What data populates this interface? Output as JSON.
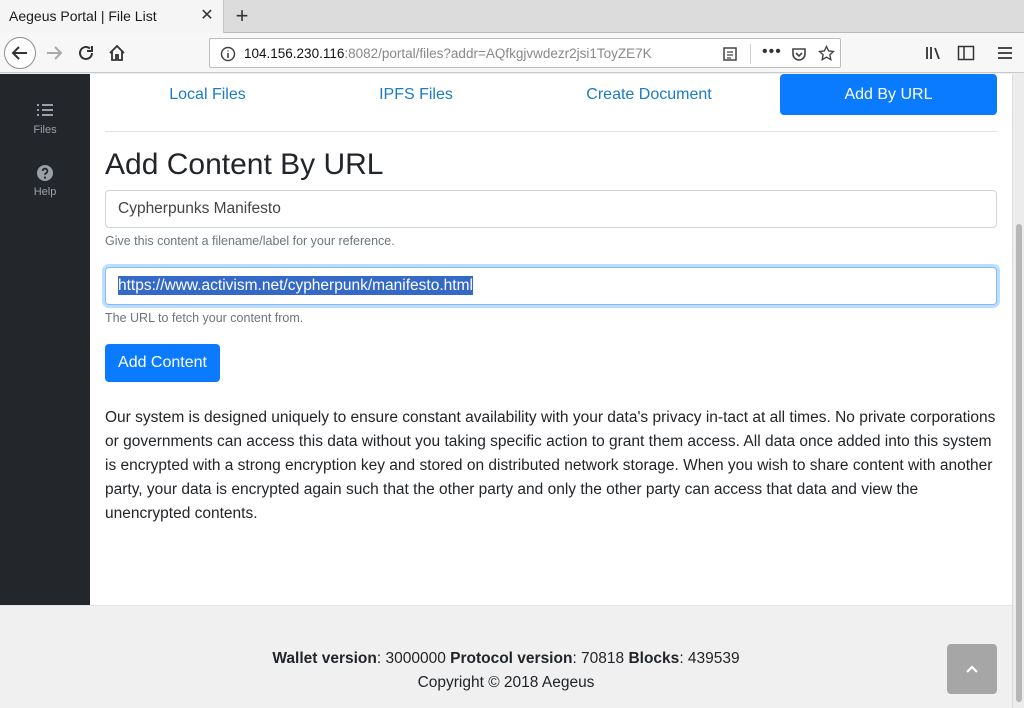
{
  "browser": {
    "tab_title": "Aegeus Portal | File List",
    "url_host": "104.156.230.116",
    "url_rest": ":8082/portal/files?addr=AQfkgjvwdezr2jsi1ToyZE7K"
  },
  "sidebar": {
    "items": [
      {
        "label": "Files",
        "icon": "list-icon"
      },
      {
        "label": "Help",
        "icon": "question-circle-icon"
      }
    ]
  },
  "tabs": [
    {
      "label": "Local Files",
      "active": false
    },
    {
      "label": "IPFS Files",
      "active": false
    },
    {
      "label": "Create Document",
      "active": false
    },
    {
      "label": "Add By URL",
      "active": true
    }
  ],
  "form": {
    "heading": "Add Content By URL",
    "name_value": "Cypherpunks Manifesto",
    "name_help": "Give this content a filename/label for your reference.",
    "url_value": "https://www.activism.net/cypherpunk/manifesto.html",
    "url_help": "The URL to fetch your content from.",
    "submit_label": "Add Content"
  },
  "description": "Our system is designed uniquely to ensure constant availability with your data's privacy in-tact at all times. No private corporations or governments can access this data without you taking specific action to grant them access. All data once added into this system is encrypted with a strong encryption key and stored on distributed network storage. When you wish to share content with another party, your data is encrypted again such that the other party and only the other party can access that data and view the unencrypted contents.",
  "footer": {
    "wallet_label": "Wallet version",
    "wallet_value": ": 3000000 ",
    "protocol_label": "Protocol version",
    "protocol_value": ": 70818 ",
    "blocks_label": "Blocks",
    "blocks_value": ": 439539",
    "copyright": "Copyright © 2018 Aegeus"
  },
  "colors": {
    "primary": "#0a7bff",
    "link": "#1a7bc8",
    "sidebar_bg": "#23272b"
  }
}
